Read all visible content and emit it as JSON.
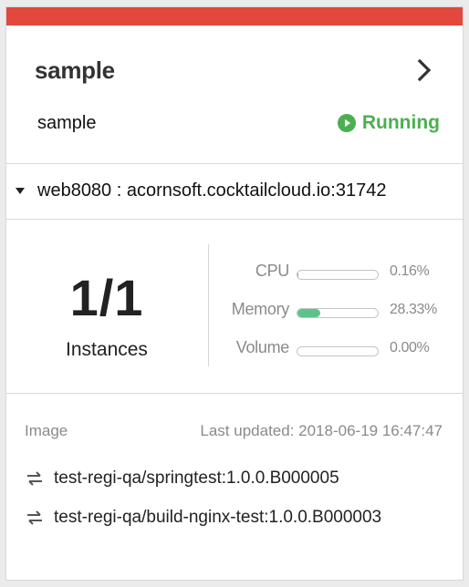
{
  "colors": {
    "accent": "#e2483d",
    "status": "#4caf50",
    "bar_fill": "#5cc48a"
  },
  "header": {
    "title": "sample",
    "subtitle": "sample",
    "status": "Running",
    "status_icon": "play-circle-icon",
    "nav_icon": "chevron-right-icon"
  },
  "endpoint": {
    "text": "web8080 : acornsoft.cocktailcloud.io:31742",
    "toggle_icon": "caret-down-icon"
  },
  "instances": {
    "count": "1/1",
    "label": "Instances"
  },
  "metrics": [
    {
      "label": "CPU",
      "value": "0.16%",
      "fraction": 0.0016
    },
    {
      "label": "Memory",
      "value": "28.33%",
      "fraction": 0.2833
    },
    {
      "label": "Volume",
      "value": "0.00%",
      "fraction": 0.0
    }
  ],
  "images": {
    "label": "Image",
    "last_updated": "Last updated: 2018-06-19 16:47:47",
    "items": [
      {
        "name": "test-regi-qa/springtest:1.0.0.B000005",
        "icon": "swap-icon"
      },
      {
        "name": "test-regi-qa/build-nginx-test:1.0.0.B000003",
        "icon": "swap-icon"
      }
    ]
  }
}
